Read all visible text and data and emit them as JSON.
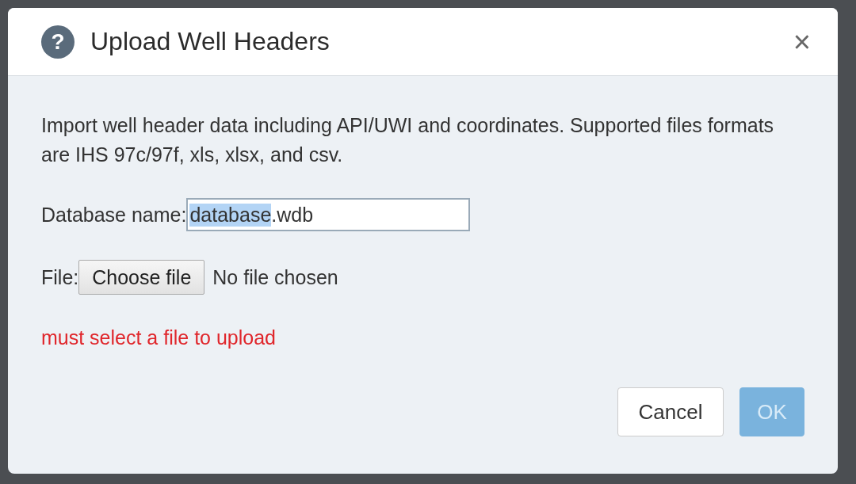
{
  "dialog": {
    "help_icon": "?",
    "title": "Upload Well Headers",
    "close": "×",
    "description": "Import well header data including API/UWI and coordinates. Supported files formats are IHS 97c/97f, xls, xlsx, and csv.",
    "database_field": {
      "label": "Database name:",
      "value_selected": "database",
      "value_rest": ".wdb"
    },
    "file_field": {
      "label": "File:",
      "button": "Choose file",
      "status": "No file chosen"
    },
    "error": "must select a file to upload",
    "buttons": [
      {
        "label": "Cancel",
        "kind": "secondary",
        "disabled": false
      },
      {
        "label": "OK",
        "kind": "primary",
        "disabled": true
      }
    ]
  }
}
